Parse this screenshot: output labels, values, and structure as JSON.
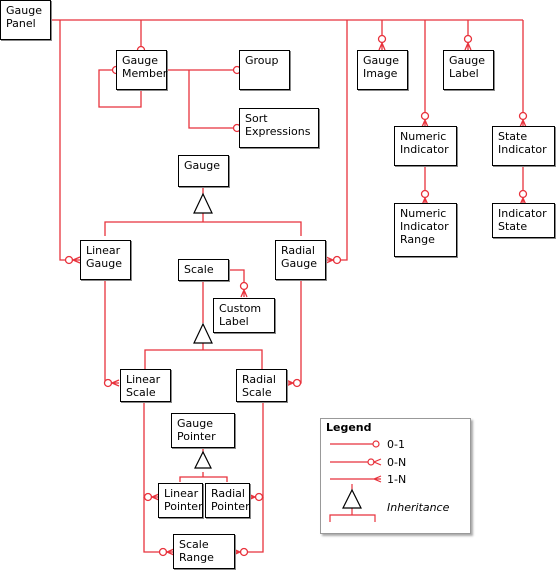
{
  "diagram": {
    "line_color": "#e8323c",
    "entities": {
      "gauge_panel": "Gauge\nPanel",
      "gauge_member": "Gauge\nMember",
      "group": "Group",
      "sort_expressions": "Sort\nExpressions",
      "gauge_image": "Gauge\nImage",
      "gauge_label": "Gauge\nLabel",
      "numeric_indicator": "Numeric\nIndicator",
      "state_indicator": "State\nIndicator",
      "numeric_indicator_range": "Numeric\nIndicator\nRange",
      "indicator_state": "Indicator\nState",
      "gauge": "Gauge",
      "linear_gauge": "Linear\nGauge",
      "radial_gauge": "Radial\nGauge",
      "scale": "Scale",
      "custom_label": "Custom\nLabel",
      "linear_scale": "Linear\nScale",
      "radial_scale": "Radial\nScale",
      "gauge_pointer": "Gauge\nPointer",
      "linear_pointer": "Linear\nPointer",
      "radial_pointer": "Radial\nPointer",
      "scale_range": "Scale\nRange"
    },
    "legend": {
      "title": "Legend",
      "items": [
        {
          "symbol": "zero-or-one",
          "label": "0-1"
        },
        {
          "symbol": "zero-or-many",
          "label": "0-N"
        },
        {
          "symbol": "one-or-many",
          "label": "1-N"
        },
        {
          "symbol": "inheritance",
          "label": "Inheritance"
        }
      ]
    }
  }
}
